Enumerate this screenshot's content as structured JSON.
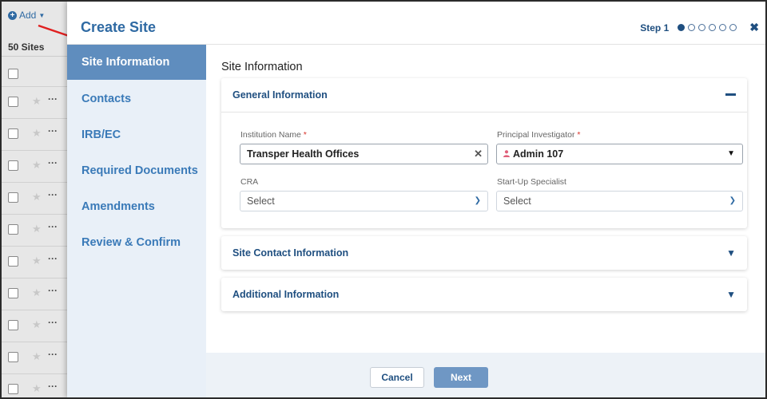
{
  "background_list": {
    "add_label": "Add",
    "count_label": "50 Sites",
    "row_count": 10
  },
  "modal": {
    "title": "Create Site",
    "step_label": "Step 1",
    "steps_total": 6,
    "active_step": 1,
    "close_icon": "close-icon"
  },
  "nav": {
    "items": [
      {
        "label": "Site Information",
        "active": true
      },
      {
        "label": "Contacts",
        "active": false
      },
      {
        "label": "IRB/EC",
        "active": false
      },
      {
        "label": "Required Documents",
        "active": false
      },
      {
        "label": "Amendments",
        "active": false
      },
      {
        "label": "Review & Confirm",
        "active": false
      }
    ]
  },
  "main": {
    "title": "Site Information",
    "general": {
      "heading": "General Information",
      "institution_label": "Institution Name",
      "institution_value": "Transper Health Offices",
      "pi_label": "Principal Investigator",
      "pi_value": "Admin 107",
      "cra_label": "CRA",
      "cra_value": "Select",
      "startup_label": "Start-Up Specialist",
      "startup_value": "Select",
      "required_mark": "*"
    },
    "site_contact_heading": "Site Contact Information",
    "additional_heading": "Additional Information"
  },
  "footer": {
    "cancel_label": "Cancel",
    "next_label": "Next"
  },
  "colors": {
    "brand_blue": "#2f6aa3",
    "nav_active": "#5f8dbe",
    "required": "#d9342b"
  }
}
